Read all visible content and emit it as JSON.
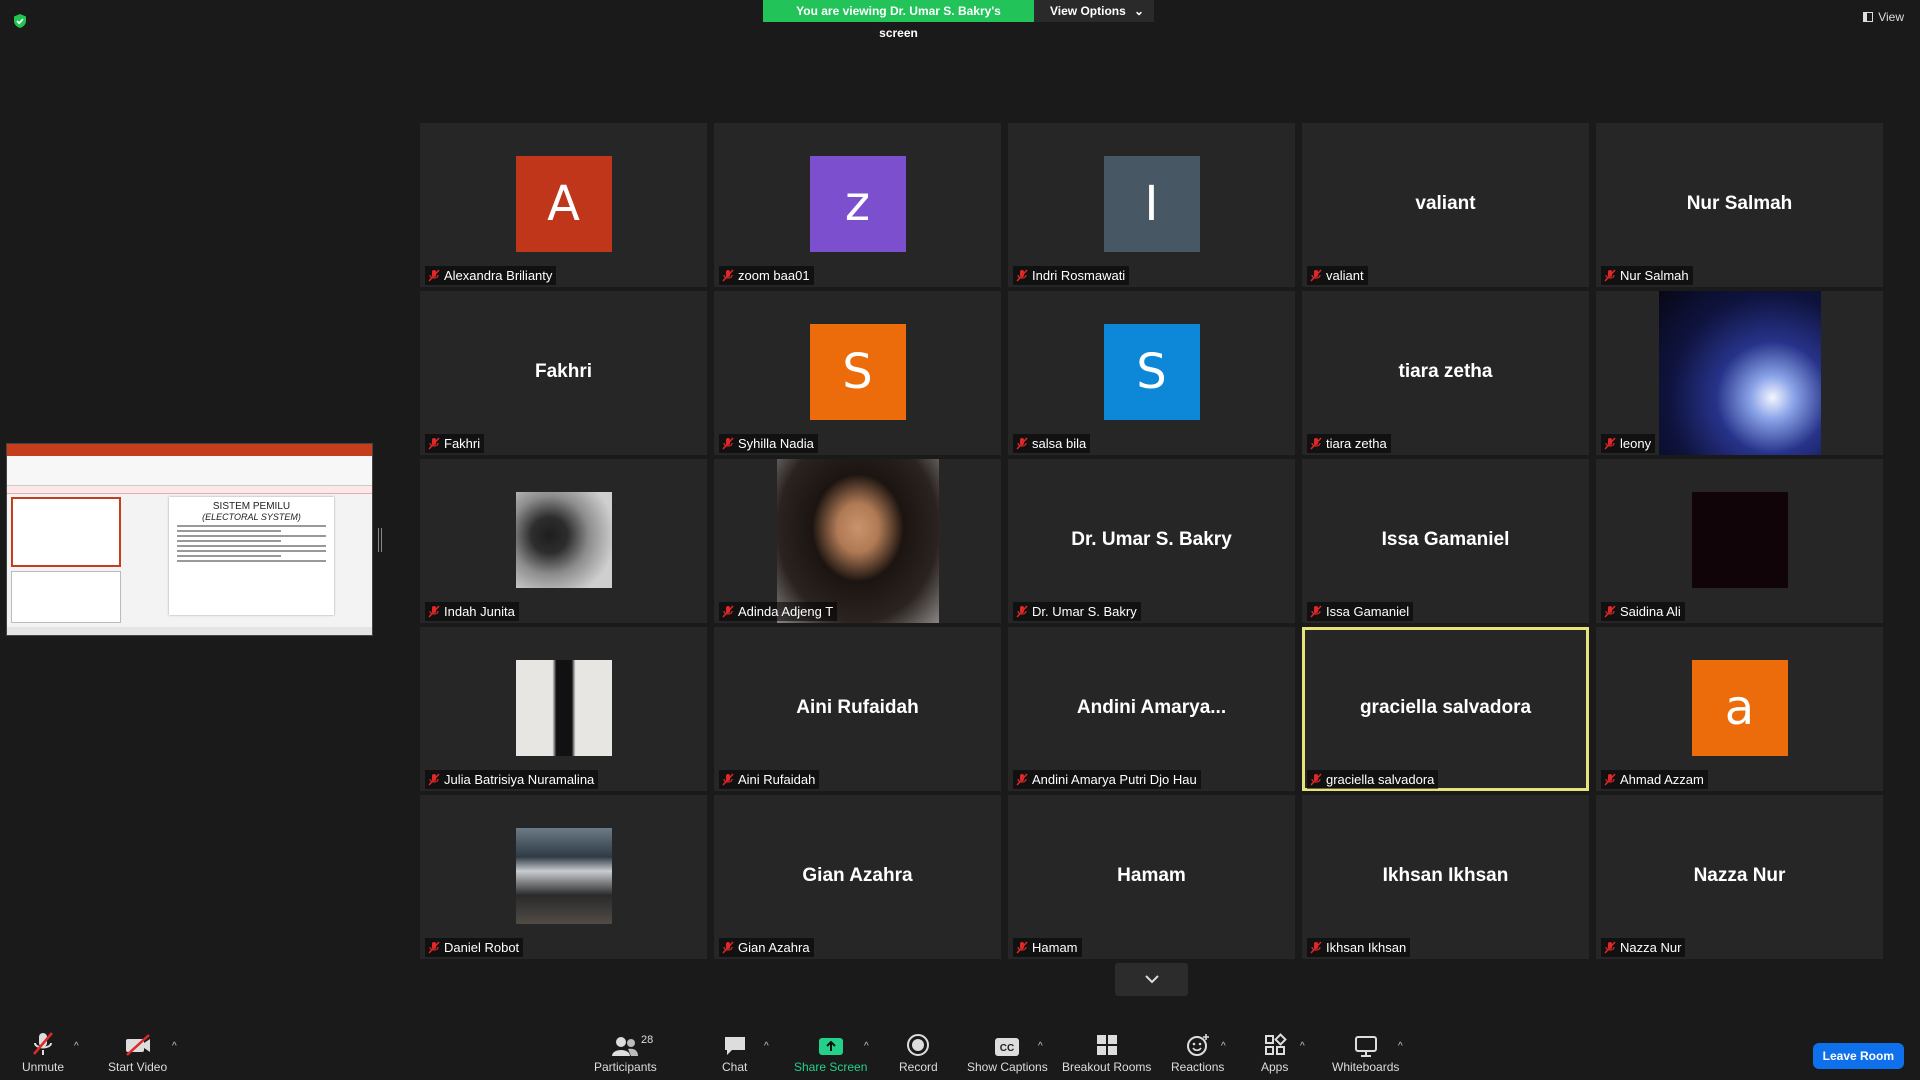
{
  "banner": {
    "share_text": "You are viewing Dr. Umar S. Bakry's screen",
    "view_options": "View Options"
  },
  "view_label": "View",
  "share_preview": {
    "slide_title": "SISTEM PEMILU",
    "slide_subtitle": "(ELECTORAL SYSTEM)"
  },
  "tiles": [
    {
      "name": "Alexandra Brilianty",
      "type": "letter",
      "letter": "A",
      "color": "#c0361a"
    },
    {
      "name": "zoom baa01",
      "type": "letter",
      "letter": "z",
      "color": "#7c4fcf"
    },
    {
      "name": "Indri Rosmawati",
      "type": "letter",
      "letter": "I",
      "color": "#475763"
    },
    {
      "name": "valiant",
      "type": "text",
      "label": "valiant"
    },
    {
      "name": "Nur Salmah",
      "type": "text",
      "label": "Nur Salmah"
    },
    {
      "name": "Fakhri",
      "type": "text",
      "label": "Fakhri"
    },
    {
      "name": "Syhilla Nadia",
      "type": "letter",
      "letter": "S",
      "color": "#ec6c0b"
    },
    {
      "name": "salsa bila",
      "type": "letter",
      "letter": "S",
      "color": "#0d88d8"
    },
    {
      "name": "tiara zetha",
      "type": "text",
      "label": "tiara zetha"
    },
    {
      "name": "leony",
      "type": "photo",
      "photo": "stage"
    },
    {
      "name": "Indah Junita",
      "type": "photo",
      "photo": "portrait-gray"
    },
    {
      "name": "Adinda Adjeng T",
      "type": "photo",
      "photo": "selfie"
    },
    {
      "name": "Dr. Umar S. Bakry",
      "type": "text",
      "label": "Dr. Umar S. Bakry"
    },
    {
      "name": "Issa Gamaniel",
      "type": "text",
      "label": "Issa Gamaniel"
    },
    {
      "name": "Saidina Ali",
      "type": "photo",
      "photo": "dark"
    },
    {
      "name": "Julia Batrisiya Nuramalina",
      "type": "photo",
      "photo": "event"
    },
    {
      "name": "Aini Rufaidah",
      "type": "text",
      "label": "Aini Rufaidah"
    },
    {
      "name": "Andini Amarya Putri Djo Hau",
      "type": "text",
      "label": "Andini  Amarya..."
    },
    {
      "name": "graciella salvadora",
      "type": "text",
      "label": "graciella salvadora",
      "active": true
    },
    {
      "name": "Ahmad Azzam",
      "type": "letter",
      "letter": "a",
      "color": "#ec6c0b"
    },
    {
      "name": "Daniel Robot",
      "type": "photo",
      "photo": "group"
    },
    {
      "name": "Gian Azahra",
      "type": "text",
      "label": "Gian Azahra"
    },
    {
      "name": "Hamam",
      "type": "text",
      "label": "Hamam"
    },
    {
      "name": "Ikhsan Ikhsan",
      "type": "text",
      "label": "Ikhsan Ikhsan"
    },
    {
      "name": "Nazza Nur",
      "type": "text",
      "label": "Nazza Nur"
    }
  ],
  "toolbar": {
    "unmute": "Unmute",
    "start_video": "Start Video",
    "participants": "Participants",
    "participants_count": "28",
    "chat": "Chat",
    "share_screen": "Share Screen",
    "record": "Record",
    "show_captions": "Show Captions",
    "breakout_rooms": "Breakout Rooms",
    "reactions": "Reactions",
    "apps": "Apps",
    "whiteboards": "Whiteboards",
    "leave_room": "Leave Room"
  },
  "colors": {
    "share_green": "#22c45a",
    "active_speaker": "#e8e27a",
    "leave_blue": "#0e71eb",
    "muted_red": "#e02828"
  }
}
